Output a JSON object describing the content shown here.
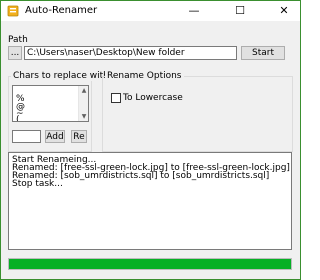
{
  "window": {
    "title": "Auto-Renamer",
    "minimize_glyph": "—",
    "maximize_glyph": "☐",
    "close_glyph": "✕"
  },
  "path": {
    "label": "Path",
    "browse_label": "...",
    "value": "C:\\Users\\naser\\Desktop\\New folder",
    "start_label": "Start"
  },
  "chars": {
    "group_label": "Chars to replace with -",
    "items": [
      "%",
      "@",
      "~",
      "("
    ],
    "new_value": "",
    "add_label": "Add",
    "remove_label": "Re"
  },
  "rename_options": {
    "group_label": "Rename Options",
    "lowercase_label": "To Lowercase",
    "lowercase_checked": false
  },
  "log": {
    "lines": [
      "Start Renameing...",
      "Renamed: [free-ssl-green-lock.jpg] to [free-ssl-green-lock.jpg]",
      "Renamed: [sob_umrdistricts.sql] to [sob_umrdistricts.sql]",
      "Stop task..."
    ]
  },
  "progress": {
    "value_percent": 100,
    "color": "#06b025"
  },
  "colors": {
    "window_border": "#3a8f2f",
    "icon": "#f2b01e"
  }
}
